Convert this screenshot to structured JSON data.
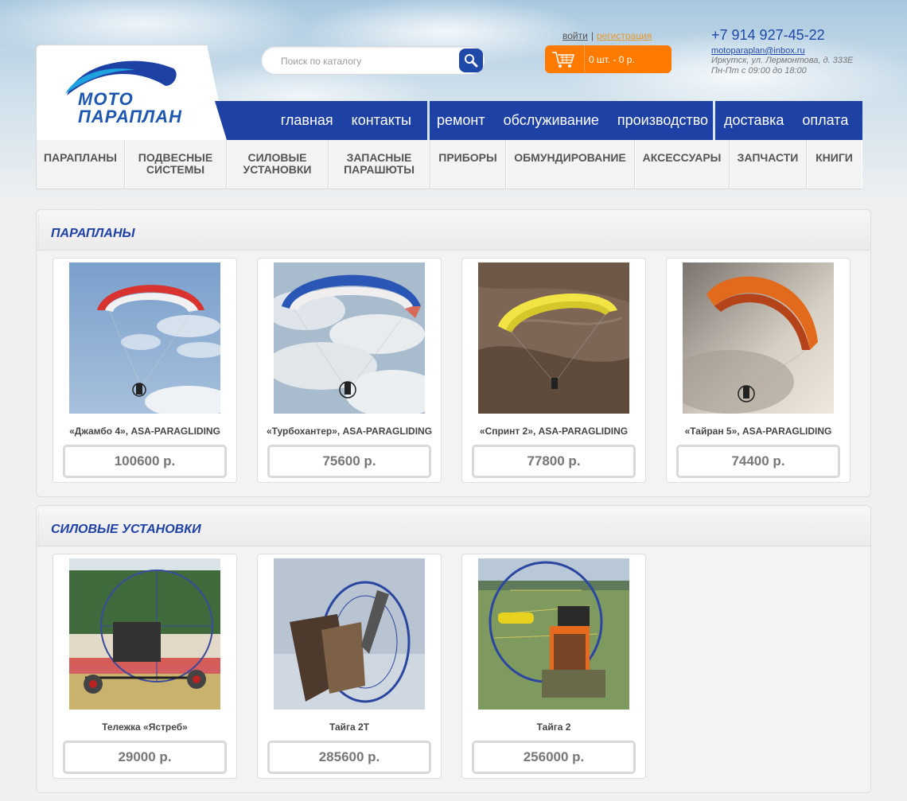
{
  "header": {
    "logo_line1": "МОТО",
    "logo_line2": "ПАРАПЛАН",
    "search_placeholder": "Поиск по каталогу",
    "login_label": "войти",
    "register_label": "регистрация",
    "auth_separator": "|",
    "cart_text": "0 шт. - 0 р.",
    "phone": "+7 914 927-45-22",
    "email": "motoparaplan@inbox.ru",
    "address": "Иркутск, ул. Лермонтова, д. 333Е",
    "hours": "Пн-Пт с 09:00 до 18:00"
  },
  "topnav": {
    "group1": [
      "главная",
      "контакты"
    ],
    "group2": [
      "ремонт",
      "обслуживание",
      "производство"
    ],
    "group3": [
      "доставка",
      "оплата"
    ]
  },
  "catnav": [
    {
      "line1": "ПАРАПЛАНЫ",
      "line2": ""
    },
    {
      "line1": "ПОДВЕСНЫЕ",
      "line2": "СИСТЕМЫ"
    },
    {
      "line1": "СИЛОВЫЕ",
      "line2": "УСТАНОВКИ"
    },
    {
      "line1": "ЗАПАСНЫЕ",
      "line2": "ПАРАШЮТЫ"
    },
    {
      "line1": "ПРИБОРЫ",
      "line2": ""
    },
    {
      "line1": "ОБМУНДИРОВАНИЕ",
      "line2": ""
    },
    {
      "line1": "АКСЕССУАРЫ",
      "line2": ""
    },
    {
      "line1": "ЗАПЧАСТИ",
      "line2": ""
    },
    {
      "line1": "КНИГИ",
      "line2": ""
    }
  ],
  "sections": [
    {
      "title": "ПАРАПЛАНЫ",
      "products": [
        {
          "name": "«Джамбо 4», ASA-PARAGLIDING",
          "price": "100600 р.",
          "image": "paraglider-red-white"
        },
        {
          "name": "«Турбохантер», ASA-PARAGLIDING",
          "price": "75600 р.",
          "image": "paraglider-blue-white"
        },
        {
          "name": "«Спринт 2», ASA-PARAGLIDING",
          "price": "77800 р.",
          "image": "paraglider-yellow-hills"
        },
        {
          "name": "«Тайран 5», ASA-PARAGLIDING",
          "price": "74400 р.",
          "image": "paraglider-orange-sunset"
        }
      ]
    },
    {
      "title": "СИЛОВЫЕ УСТАНОВКИ",
      "products": [
        {
          "name": "Тележка «Ястреб»",
          "price": "29000 р.",
          "image": "paramotor-trike"
        },
        {
          "name": "Тайга 2Т",
          "price": "285600 р.",
          "image": "paramotor-cage-side"
        },
        {
          "name": "Тайга 2",
          "price": "256000 р.",
          "image": "paramotor-cage-field"
        }
      ]
    }
  ]
}
